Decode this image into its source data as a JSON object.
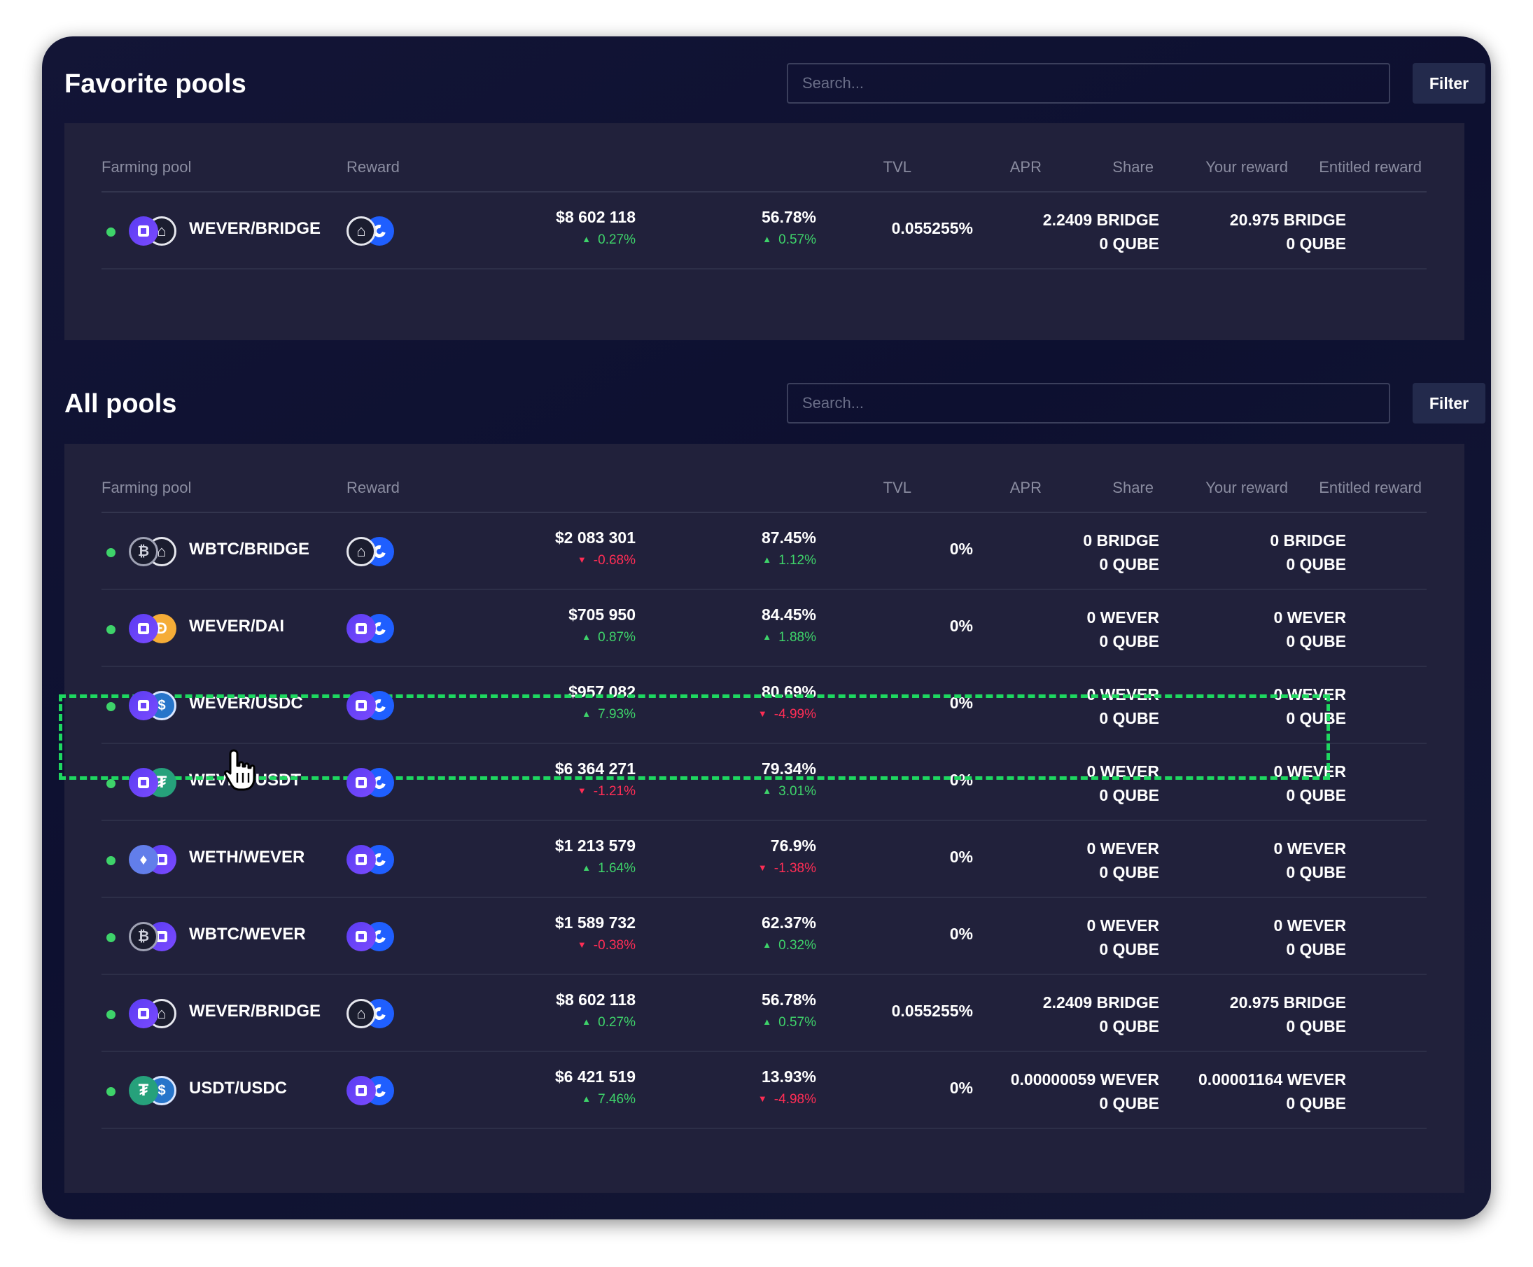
{
  "favorite": {
    "title": "Favorite pools",
    "search_placeholder": "Search...",
    "filter_label": "Filter",
    "columns": [
      "Farming pool",
      "Reward",
      "TVL",
      "APR",
      "Share",
      "Your reward",
      "Entitled reward"
    ],
    "rows": [
      {
        "tokens": [
          "wever",
          "bridge"
        ],
        "name": "WEVER/BRIDGE",
        "reward_tokens": [
          "bridge",
          "qube"
        ],
        "tvl": "$8 602 118",
        "tvl_change": "0.27%",
        "tvl_dir": "up",
        "apr": "56.78%",
        "apr_change": "0.57%",
        "apr_dir": "up",
        "share": "0.055255%",
        "your_reward": [
          "2.2409 BRIDGE",
          "0 QUBE"
        ],
        "entitled_reward": [
          "20.975 BRIDGE",
          "0 QUBE"
        ]
      }
    ]
  },
  "all": {
    "title": "All pools",
    "search_placeholder": "Search...",
    "filter_label": "Filter",
    "columns": [
      "Farming pool",
      "Reward",
      "TVL",
      "APR",
      "Share",
      "Your reward",
      "Entitled reward"
    ],
    "rows": [
      {
        "tokens": [
          "btc",
          "bridge"
        ],
        "name": "WBTC/BRIDGE",
        "reward_tokens": [
          "bridge",
          "qube"
        ],
        "tvl": "$2 083 301",
        "tvl_change": "-0.68%",
        "tvl_dir": "down",
        "apr": "87.45%",
        "apr_change": "1.12%",
        "apr_dir": "up",
        "share": "0%",
        "your_reward": [
          "0 BRIDGE",
          "0 QUBE"
        ],
        "entitled_reward": [
          "0 BRIDGE",
          "0 QUBE"
        ]
      },
      {
        "tokens": [
          "wever",
          "dai"
        ],
        "name": "WEVER/DAI",
        "reward_tokens": [
          "wever",
          "qube"
        ],
        "tvl": "$705 950",
        "tvl_change": "0.87%",
        "tvl_dir": "up",
        "apr": "84.45%",
        "apr_change": "1.88%",
        "apr_dir": "up",
        "share": "0%",
        "your_reward": [
          "0 WEVER",
          "0 QUBE"
        ],
        "entitled_reward": [
          "0 WEVER",
          "0 QUBE"
        ]
      },
      {
        "tokens": [
          "wever",
          "usdc"
        ],
        "name": "WEVER/USDC",
        "reward_tokens": [
          "wever",
          "qube"
        ],
        "tvl": "$957 082",
        "tvl_change": "7.93%",
        "tvl_dir": "up",
        "apr": "80.69%",
        "apr_change": "-4.99%",
        "apr_dir": "down",
        "share": "0%",
        "your_reward": [
          "0 WEVER",
          "0 QUBE"
        ],
        "entitled_reward": [
          "0 WEVER",
          "0 QUBE"
        ]
      },
      {
        "tokens": [
          "wever",
          "usdt"
        ],
        "name": "WEVER/USDT",
        "reward_tokens": [
          "wever",
          "qube"
        ],
        "tvl": "$6 364 271",
        "tvl_change": "-1.21%",
        "tvl_dir": "down",
        "apr": "79.34%",
        "apr_change": "3.01%",
        "apr_dir": "up",
        "share": "0%",
        "your_reward": [
          "0 WEVER",
          "0 QUBE"
        ],
        "entitled_reward": [
          "0 WEVER",
          "0 QUBE"
        ]
      },
      {
        "tokens": [
          "weth",
          "wever"
        ],
        "name": "WETH/WEVER",
        "reward_tokens": [
          "wever",
          "qube"
        ],
        "tvl": "$1 213 579",
        "tvl_change": "1.64%",
        "tvl_dir": "up",
        "apr": "76.9%",
        "apr_change": "-1.38%",
        "apr_dir": "down",
        "share": "0%",
        "your_reward": [
          "0 WEVER",
          "0 QUBE"
        ],
        "entitled_reward": [
          "0 WEVER",
          "0 QUBE"
        ]
      },
      {
        "tokens": [
          "btc",
          "wever"
        ],
        "name": "WBTC/WEVER",
        "reward_tokens": [
          "wever",
          "qube"
        ],
        "tvl": "$1 589 732",
        "tvl_change": "-0.38%",
        "tvl_dir": "down",
        "apr": "62.37%",
        "apr_change": "0.32%",
        "apr_dir": "up",
        "share": "0%",
        "your_reward": [
          "0 WEVER",
          "0 QUBE"
        ],
        "entitled_reward": [
          "0 WEVER",
          "0 QUBE"
        ]
      },
      {
        "tokens": [
          "wever",
          "bridge"
        ],
        "name": "WEVER/BRIDGE",
        "reward_tokens": [
          "bridge",
          "qube"
        ],
        "tvl": "$8 602 118",
        "tvl_change": "0.27%",
        "tvl_dir": "up",
        "apr": "56.78%",
        "apr_change": "0.57%",
        "apr_dir": "up",
        "share": "0.055255%",
        "your_reward": [
          "2.2409 BRIDGE",
          "0 QUBE"
        ],
        "entitled_reward": [
          "20.975 BRIDGE",
          "0 QUBE"
        ]
      },
      {
        "tokens": [
          "usdt",
          "usdc"
        ],
        "name": "USDT/USDC",
        "reward_tokens": [
          "wever",
          "qube"
        ],
        "tvl": "$6 421 519",
        "tvl_change": "7.46%",
        "tvl_dir": "up",
        "apr": "13.93%",
        "apr_change": "-4.98%",
        "apr_dir": "down",
        "share": "0%",
        "your_reward": [
          "0.00000059 WEVER",
          "0 QUBE"
        ],
        "entitled_reward": [
          "0.00001164 WEVER",
          "0 QUBE"
        ]
      }
    ]
  },
  "colors": {
    "positive": "#3ed36a",
    "negative": "#ff2d55",
    "highlight": "#1ed760"
  },
  "icons": {
    "wever": "wever-icon",
    "bridge": "bridge-icon",
    "qube": "qube-icon",
    "btc": "wbtc-icon",
    "dai": "dai-icon",
    "usdc": "usdc-icon",
    "usdt": "usdt-icon",
    "weth": "weth-icon",
    "status": "active-status-dot",
    "cursor": "hand-cursor-icon"
  }
}
